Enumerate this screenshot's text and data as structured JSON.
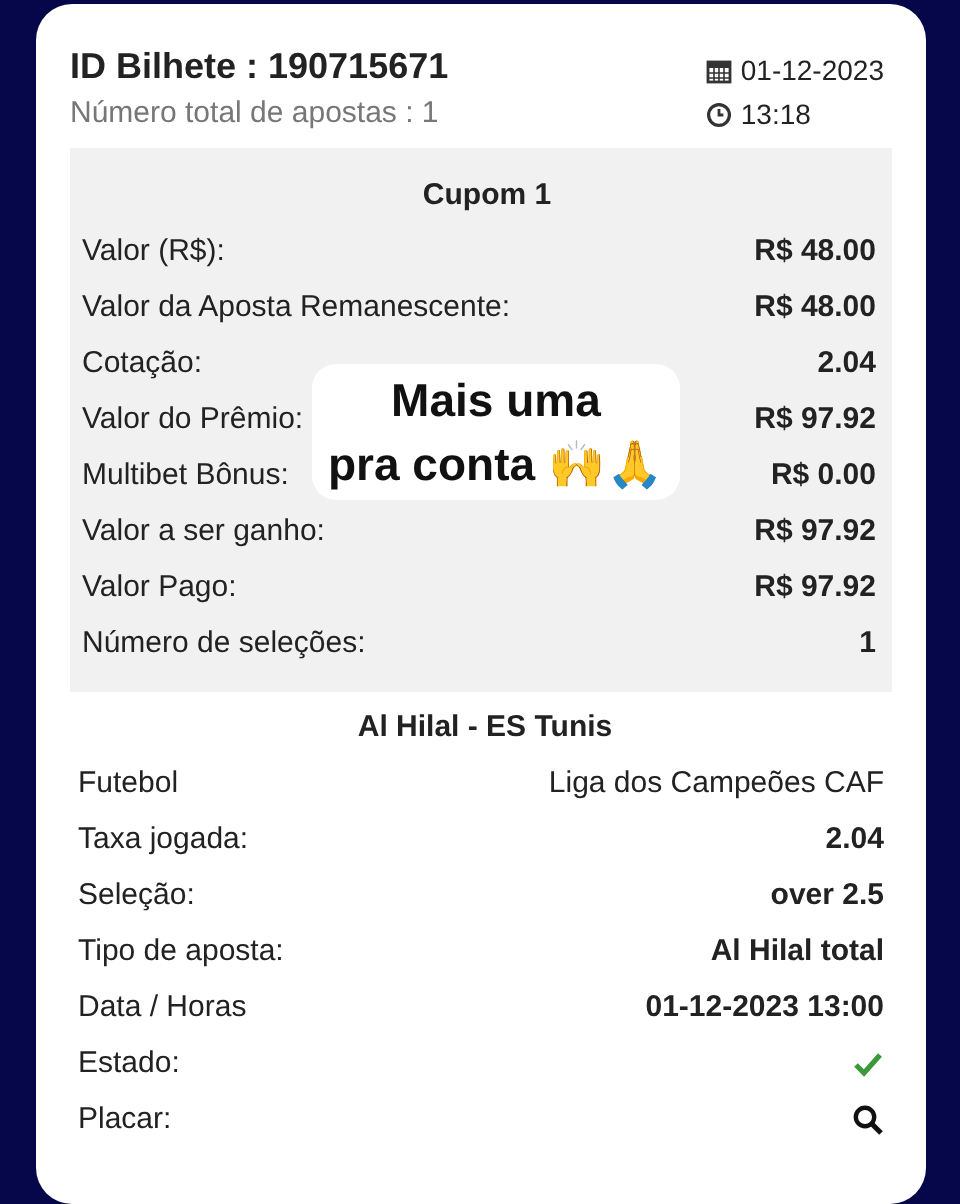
{
  "ticket": {
    "title": "ID Bilhete : 190715671",
    "subtitle": "Número total de apostas : 1",
    "date": "01-12-2023",
    "time": "13:18"
  },
  "coupon": {
    "title": "Cupom 1",
    "rows": [
      {
        "label": "Valor (R$):",
        "value": "R$ 48.00"
      },
      {
        "label": "Valor da Aposta Remanescente:",
        "value": "R$ 48.00"
      },
      {
        "label": "Cotação:",
        "value": "2.04"
      },
      {
        "label": "Valor do Prêmio:",
        "value": "R$ 97.92"
      },
      {
        "label": "Multibet Bônus:",
        "value": "R$ 0.00"
      },
      {
        "label": "Valor a ser ganho:",
        "value": "R$ 97.92"
      },
      {
        "label": "Valor Pago:",
        "value": "R$ 97.92"
      },
      {
        "label": "Número de seleções:",
        "value": "1"
      }
    ]
  },
  "match": {
    "title": "Al Hilal - ES Tunis",
    "rows": [
      {
        "kind": "text",
        "label": "Futebol",
        "value": "Liga dos Campeões CAF"
      },
      {
        "kind": "text",
        "label": "Taxa jogada:",
        "value": "2.04"
      },
      {
        "kind": "text",
        "label": "Seleção:",
        "value": "over 2.5"
      },
      {
        "kind": "text",
        "label": "Tipo de aposta:",
        "value": "Al Hilal total"
      },
      {
        "kind": "text",
        "label": "Data / Horas",
        "value": "01-12-2023 13:00"
      },
      {
        "kind": "check",
        "label": "Estado:"
      },
      {
        "kind": "search",
        "label": "Placar:"
      }
    ]
  },
  "sticker": {
    "line_1": "Mais uma",
    "line_2": "pra conta 🙌🙏"
  }
}
